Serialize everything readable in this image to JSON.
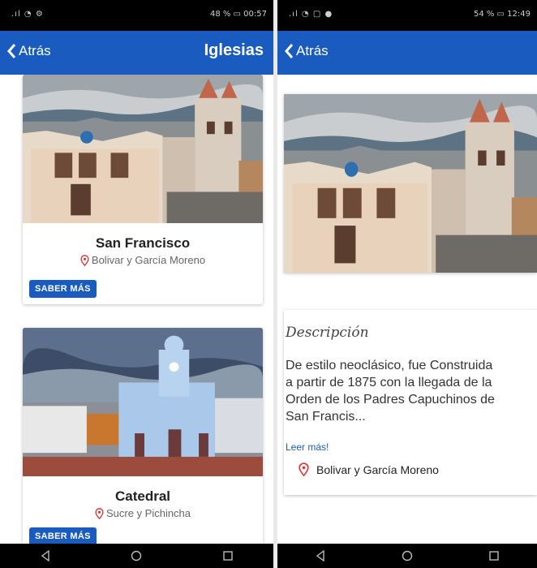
{
  "left_screen": {
    "status_bar": {
      "left": ".ıl ◔ ⚙",
      "right": "48 % ▭ 00:57"
    },
    "app_bar": {
      "back_label": "Atrás",
      "title": "Iglesias"
    },
    "cards": [
      {
        "title": "San Francisco",
        "address": "Bolivar y García Moreno",
        "button": "SABER MÁS"
      },
      {
        "title": "Catedral",
        "address": "Sucre y Pichincha",
        "button": "SABER MÁS"
      }
    ]
  },
  "right_screen": {
    "status_bar": {
      "left": ".ıl ◔ ▢ ●",
      "right": "54 % ▭ 12:49"
    },
    "app_bar": {
      "back_label": "Atrás"
    },
    "description": {
      "title": "Descripción",
      "text": "De estilo neoclásico, fue Construida\na partir de 1875 con la llegada de la\nOrden de los Padres Capuchinos de\nSan Francis...",
      "read_more": "Leer más!",
      "address": "Bolivar y García Moreno"
    }
  },
  "colors": {
    "primary": "#1a5bbf",
    "pin": "#d93a3a"
  },
  "icons": [
    "back-chevron-icon",
    "location-pin-icon",
    "nav-back-icon",
    "nav-home-icon",
    "nav-recents-icon"
  ]
}
